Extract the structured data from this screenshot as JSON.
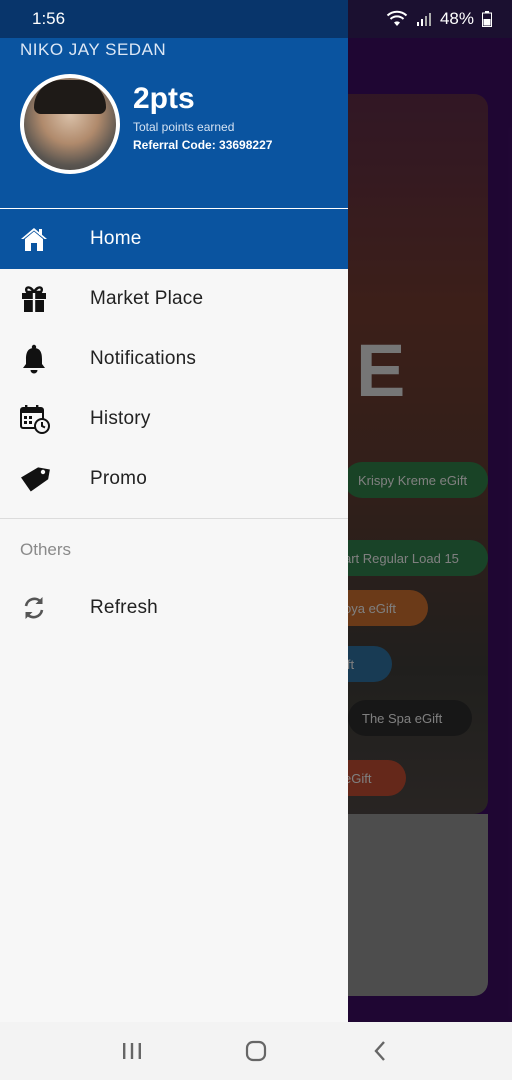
{
  "status_bar": {
    "time": "1:56",
    "battery": "48%",
    "icons": [
      "wifi-icon",
      "signal-icon",
      "battery-icon"
    ]
  },
  "drawer": {
    "user_name": "NIKO JAY SEDAN",
    "points": "2pts",
    "points_caption": "Total points earned",
    "referral": "Referral Code: 33698227",
    "menu": [
      {
        "label": "Home",
        "icon": "home-icon",
        "active": true
      },
      {
        "label": "Market Place",
        "icon": "gift-icon",
        "active": false
      },
      {
        "label": "Notifications",
        "icon": "bell-icon",
        "active": false
      },
      {
        "label": "History",
        "icon": "calendar-clock-icon",
        "active": false
      },
      {
        "label": "Promo",
        "icon": "tag-icon",
        "active": false
      }
    ],
    "others_label": "Others",
    "others_menu": [
      {
        "label": "Refresh",
        "icon": "refresh-icon"
      }
    ]
  },
  "background": {
    "big_letter": "E",
    "chips": [
      {
        "label": "Krispy Kreme eGift"
      },
      {
        "label": "art Regular Load 15"
      },
      {
        "label": "oya eGift"
      },
      {
        "label": "ift"
      },
      {
        "label": "The Spa eGift"
      },
      {
        "label": "eGift"
      }
    ]
  },
  "colors": {
    "primary": "#0a54a0",
    "status_bar": "#08356b",
    "drawer_bg": "#f7f7f7",
    "background_app": "#3a0c5e"
  }
}
